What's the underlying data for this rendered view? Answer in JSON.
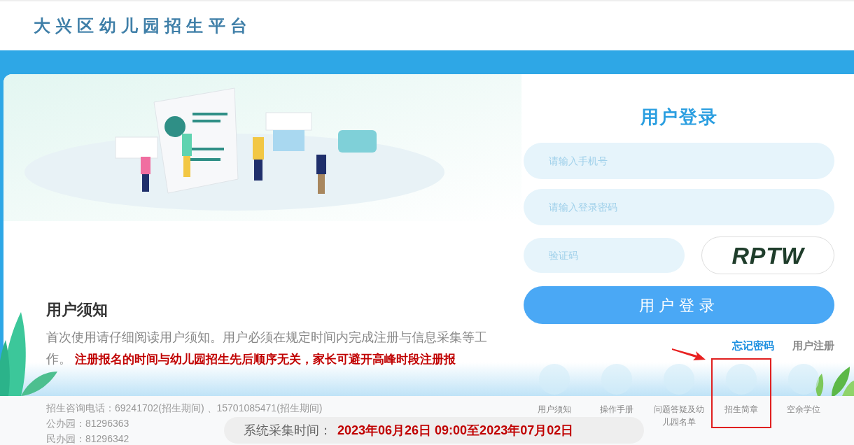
{
  "site_title": "大兴区幼儿园招生平台",
  "notice": {
    "heading": "用户须知",
    "text": "首次使用请仔细阅读用户须知。用户必须在规定时间内完成注册与信息采集等工作。 **注册报名的时间与幼儿园招生先后顺序无关，家长可避开高峰时段注册报**"
  },
  "login": {
    "title": "用户登录",
    "fields": [
      {
        "placeholder": "请输入手机号"
      },
      {
        "placeholder": "请输入登录密码"
      }
    ],
    "captcha": {
      "placeholder": "验证码",
      "image_text": "RPTW"
    },
    "button": "用户登录",
    "links": [
      {
        "label": "忘记密码",
        "highlighted": true
      },
      {
        "label": "用户注册",
        "highlighted": false
      }
    ]
  },
  "quick_links": [
    {
      "label": "用户须知",
      "marked": false
    },
    {
      "label": "操作手册",
      "marked": false
    },
    {
      "label": "问题答疑及幼儿园名单",
      "marked": false
    },
    {
      "label": "招生简章",
      "marked": true
    },
    {
      "label": "空余学位",
      "marked": false
    }
  ],
  "contact": [
    "招生咨询电话：69241702(招生期间) 、15701085471(招生期间)",
    "公办园：81296363",
    "民办园：81296342"
  ],
  "collection_time": {
    "label": "系统采集时间：",
    "value": "2023年06月26日 09:00至2023年07月02日"
  }
}
